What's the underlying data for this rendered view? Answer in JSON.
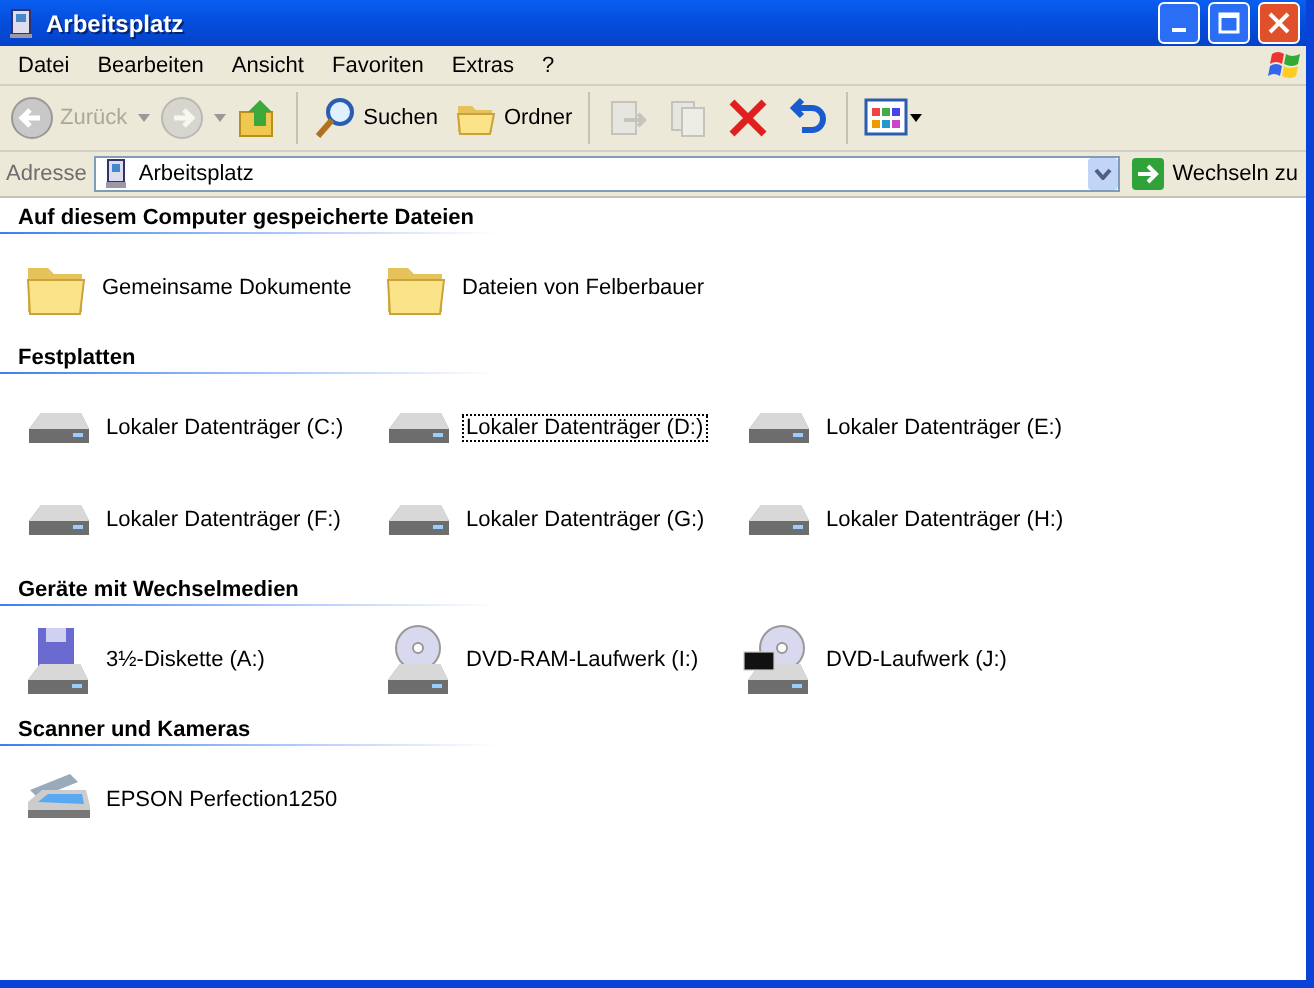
{
  "window": {
    "title": "Arbeitsplatz"
  },
  "menu": [
    "Datei",
    "Bearbeiten",
    "Ansicht",
    "Favoriten",
    "Extras",
    "?"
  ],
  "toolbar": [
    {
      "kind": "back",
      "label": "Zurück",
      "disabled": true
    },
    {
      "kind": "forward",
      "disabled": true
    },
    {
      "kind": "up",
      "disabled": false
    },
    {
      "kind": "search",
      "label": "Suchen",
      "disabled": false
    },
    {
      "kind": "folders",
      "label": "Ordner",
      "disabled": false
    },
    {
      "kind": "move",
      "disabled": true
    },
    {
      "kind": "copy",
      "disabled": true
    },
    {
      "kind": "delete",
      "disabled": false
    },
    {
      "kind": "undo",
      "disabled": false
    },
    {
      "kind": "views",
      "disabled": false
    }
  ],
  "address": {
    "label": "Adresse",
    "value": "Arbeitsplatz",
    "go": "Wechseln zu"
  },
  "sections": [
    {
      "title": "Auf diesem Computer gespeicherte Dateien",
      "items": [
        {
          "kind": "folder",
          "label": "Gemeinsame Dokumente",
          "selected": false
        },
        {
          "kind": "folder",
          "label": "Dateien von Felberbauer",
          "selected": false
        }
      ]
    },
    {
      "title": "Festplatten",
      "items": [
        {
          "kind": "drive",
          "label": "Lokaler Datenträger (C:)",
          "selected": false
        },
        {
          "kind": "drive",
          "label": "Lokaler Datenträger (D:)",
          "selected": true
        },
        {
          "kind": "drive",
          "label": "Lokaler Datenträger (E:)",
          "selected": false
        },
        {
          "kind": "drive",
          "label": "Lokaler Datenträger (F:)",
          "selected": false
        },
        {
          "kind": "drive",
          "label": "Lokaler Datenträger (G:)",
          "selected": false
        },
        {
          "kind": "drive",
          "label": "Lokaler Datenträger (H:)",
          "selected": false
        }
      ]
    },
    {
      "title": "Geräte mit Wechselmedien",
      "items": [
        {
          "kind": "floppy",
          "label": "3½-Diskette (A:)",
          "selected": false
        },
        {
          "kind": "cdrom",
          "label": "DVD-RAM-Laufwerk (I:)",
          "selected": false
        },
        {
          "kind": "dvd",
          "label": "DVD-Laufwerk (J:)",
          "selected": false
        }
      ]
    },
    {
      "title": "Scanner und Kameras",
      "items": [
        {
          "kind": "scanner",
          "label": "EPSON Perfection1250",
          "selected": false
        }
      ]
    }
  ]
}
